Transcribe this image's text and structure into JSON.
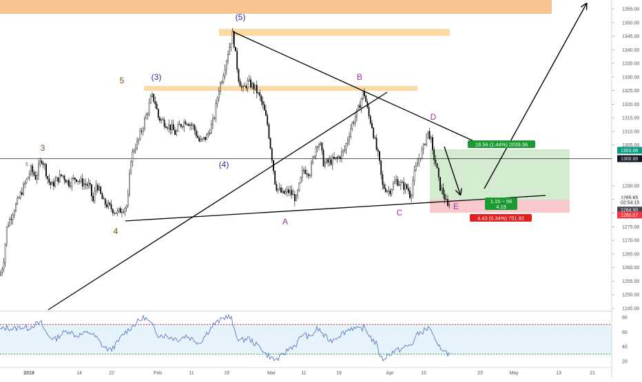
{
  "chart_data": {
    "type": "candlestick",
    "price_axis": {
      "ticks": [
        "1355.00",
        "1350.00",
        "1345.00",
        "1340.00",
        "1335.00",
        "1330.00",
        "1325.00",
        "1320.00",
        "1315.00",
        "1310.00",
        "1305.00",
        "1290.00",
        "1285.00",
        "1280.00",
        "1275.00",
        "1270.00",
        "1265.00",
        "1260.00",
        "1255.00",
        "1250.00",
        "1245.00"
      ],
      "ylim": [
        1245,
        1355
      ]
    },
    "price_tags": [
      {
        "value": "1303.06",
        "price": 1303.06,
        "color": "#089981"
      },
      {
        "value": "1300.00",
        "price": 1300.0,
        "color": "#131722"
      },
      {
        "value": "1285.65",
        "price": 1285.65,
        "color": "#ffffff"
      },
      {
        "value": "02:54:15",
        "price": 1283.9,
        "color": "#ffffff"
      },
      {
        "value": "1284.50",
        "price": 1281.1,
        "color": "#434651"
      },
      {
        "value": "1280.07",
        "price": 1279.3,
        "color": "#f23645"
      }
    ],
    "time_axis": {
      "labels": [
        "2019",
        "14",
        "22",
        "Feb",
        "11",
        "19",
        "Mar",
        "11",
        "19",
        "Apr",
        "15",
        "23",
        "May",
        "13",
        "21"
      ]
    },
    "ohlc_path": [
      [
        0,
        1257
      ],
      [
        5,
        1262
      ],
      [
        10,
        1275
      ],
      [
        18,
        1280
      ],
      [
        25,
        1284
      ],
      [
        35,
        1290
      ],
      [
        45,
        1296
      ],
      [
        52,
        1293
      ],
      [
        60,
        1300
      ],
      [
        64,
        1298
      ],
      [
        70,
        1292
      ],
      [
        75,
        1290
      ],
      [
        82,
        1292
      ],
      [
        90,
        1294
      ],
      [
        100,
        1291
      ],
      [
        110,
        1293
      ],
      [
        120,
        1291
      ],
      [
        130,
        1290
      ],
      [
        135,
        1284
      ],
      [
        140,
        1291
      ],
      [
        150,
        1284
      ],
      [
        160,
        1282
      ],
      [
        170,
        1280
      ],
      [
        180,
        1282
      ],
      [
        185,
        1283
      ],
      [
        190,
        1300
      ],
      [
        195,
        1304
      ],
      [
        200,
        1306
      ],
      [
        205,
        1310
      ],
      [
        210,
        1314
      ],
      [
        215,
        1318
      ],
      [
        220,
        1323
      ],
      [
        225,
        1321
      ],
      [
        230,
        1315
      ],
      [
        240,
        1313
      ],
      [
        250,
        1311
      ],
      [
        255,
        1309
      ],
      [
        260,
        1312
      ],
      [
        270,
        1314
      ],
      [
        280,
        1312
      ],
      [
        290,
        1306
      ],
      [
        300,
        1308
      ],
      [
        310,
        1314
      ],
      [
        318,
        1326
      ],
      [
        322,
        1329
      ],
      [
        330,
        1338
      ],
      [
        338,
        1346
      ],
      [
        342,
        1338
      ],
      [
        346,
        1330
      ],
      [
        352,
        1325
      ],
      [
        360,
        1328
      ],
      [
        370,
        1326
      ],
      [
        378,
        1322
      ],
      [
        383,
        1318
      ],
      [
        388,
        1313
      ],
      [
        395,
        1300
      ],
      [
        400,
        1290
      ],
      [
        410,
        1287
      ],
      [
        420,
        1288
      ],
      [
        430,
        1285
      ],
      [
        440,
        1296
      ],
      [
        450,
        1295
      ],
      [
        460,
        1306
      ],
      [
        465,
        1305
      ],
      [
        470,
        1298
      ],
      [
        480,
        1299
      ],
      [
        490,
        1300
      ],
      [
        500,
        1303
      ],
      [
        510,
        1312
      ],
      [
        520,
        1318
      ],
      [
        528,
        1325
      ],
      [
        535,
        1316
      ],
      [
        540,
        1312
      ],
      [
        546,
        1304
      ],
      [
        550,
        1300
      ],
      [
        555,
        1290
      ],
      [
        565,
        1288
      ],
      [
        575,
        1292
      ],
      [
        585,
        1290
      ],
      [
        592,
        1289
      ],
      [
        596,
        1286
      ],
      [
        600,
        1293
      ],
      [
        608,
        1300
      ],
      [
        615,
        1304
      ],
      [
        620,
        1310
      ],
      [
        625,
        1308
      ],
      [
        628,
        1302
      ],
      [
        633,
        1298
      ],
      [
        638,
        1290
      ],
      [
        644,
        1287
      ],
      [
        650,
        1282
      ],
      [
        653,
        1285
      ]
    ],
    "waves": [
      "(5)",
      "(3)",
      "(4)",
      "5",
      "3",
      "5",
      "4",
      "B",
      "D",
      "A",
      "C",
      "E"
    ],
    "rsi": {
      "ticks": [
        "80",
        "60",
        "40",
        "20"
      ],
      "ylim": [
        15,
        85
      ],
      "upper": 70,
      "lower": 30,
      "path": [
        [
          0,
          63
        ],
        [
          10,
          66
        ],
        [
          20,
          64
        ],
        [
          30,
          67
        ],
        [
          40,
          65
        ],
        [
          50,
          70
        ],
        [
          60,
          72
        ],
        [
          65,
          62
        ],
        [
          70,
          55
        ],
        [
          80,
          50
        ],
        [
          90,
          58
        ],
        [
          100,
          62
        ],
        [
          110,
          55
        ],
        [
          120,
          57
        ],
        [
          130,
          60
        ],
        [
          140,
          52
        ],
        [
          150,
          40
        ],
        [
          160,
          35
        ],
        [
          170,
          45
        ],
        [
          180,
          58
        ],
        [
          190,
          66
        ],
        [
          200,
          74
        ],
        [
          210,
          80
        ],
        [
          220,
          70
        ],
        [
          230,
          56
        ],
        [
          240,
          55
        ],
        [
          250,
          52
        ],
        [
          260,
          50
        ],
        [
          270,
          55
        ],
        [
          280,
          50
        ],
        [
          290,
          45
        ],
        [
          300,
          58
        ],
        [
          310,
          70
        ],
        [
          320,
          76
        ],
        [
          330,
          82
        ],
        [
          336,
          78
        ],
        [
          340,
          62
        ],
        [
          345,
          52
        ],
        [
          350,
          48
        ],
        [
          360,
          52
        ],
        [
          370,
          44
        ],
        [
          380,
          38
        ],
        [
          385,
          30
        ],
        [
          390,
          28
        ],
        [
          398,
          22
        ],
        [
          405,
          24
        ],
        [
          410,
          28
        ],
        [
          420,
          38
        ],
        [
          430,
          43
        ],
        [
          440,
          58
        ],
        [
          450,
          52
        ],
        [
          460,
          64
        ],
        [
          465,
          62
        ],
        [
          470,
          55
        ],
        [
          480,
          48
        ],
        [
          490,
          54
        ],
        [
          500,
          60
        ],
        [
          510,
          66
        ],
        [
          520,
          63
        ],
        [
          528,
          66
        ],
        [
          535,
          58
        ],
        [
          540,
          50
        ],
        [
          546,
          44
        ],
        [
          550,
          33
        ],
        [
          555,
          22
        ],
        [
          560,
          26
        ],
        [
          570,
          33
        ],
        [
          580,
          36
        ],
        [
          590,
          40
        ],
        [
          598,
          43
        ],
        [
          605,
          56
        ],
        [
          612,
          60
        ],
        [
          620,
          64
        ],
        [
          625,
          67
        ],
        [
          628,
          56
        ],
        [
          635,
          40
        ],
        [
          642,
          38
        ],
        [
          648,
          32
        ],
        [
          653,
          30
        ]
      ]
    },
    "position": {
      "target_label": "18.56 (1.44%) 2039.36",
      "stop_label": "4.43 (0.34%) 751.92",
      "center_line1": "1.15 ~ 56",
      "center_line2": "4.19"
    }
  }
}
